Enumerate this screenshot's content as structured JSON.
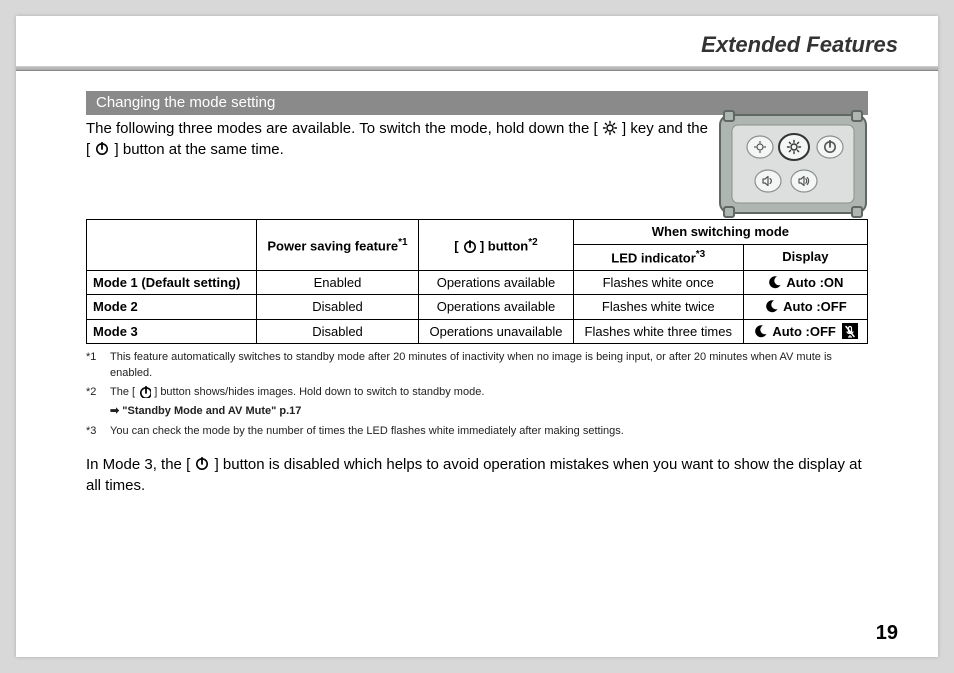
{
  "page": {
    "title": "Extended Features",
    "number": "19"
  },
  "section": {
    "heading": "Changing the mode setting",
    "intro_a": "The following three modes are available. To switch the mode, hold down the [",
    "intro_b": "] key and the [",
    "intro_c": "] button at the same time."
  },
  "icons": {
    "brightness": "brightness-icon",
    "power": "power-icon",
    "moon": "moon-icon",
    "no_mic": "mic-off-icon"
  },
  "table": {
    "headers": {
      "power_saving": "Power saving feature",
      "power_saving_sup": "*1",
      "button_prefix": "[",
      "button_suffix": "] button",
      "button_sup": "*2",
      "switching": "When switching mode",
      "led": "LED indicator",
      "led_sup": "*3",
      "display": "Display"
    },
    "rows": [
      {
        "name": "Mode 1 (Default setting)",
        "power_saving": "Enabled",
        "button": "Operations available",
        "led": "Flashes white once",
        "display_text": "Auto :ON",
        "show_mic_off": false
      },
      {
        "name": "Mode 2",
        "power_saving": "Disabled",
        "button": "Operations available",
        "led": "Flashes white twice",
        "display_text": "Auto :OFF",
        "show_mic_off": false
      },
      {
        "name": "Mode 3",
        "power_saving": "Disabled",
        "button": "Operations unavailable",
        "led": "Flashes white three times",
        "display_text": "Auto :OFF",
        "show_mic_off": true
      }
    ]
  },
  "footnotes": {
    "f1_mark": "*1",
    "f1_text": "This feature automatically switches to standby mode after 20 minutes of inactivity when no image is being input, or after 20 minutes when AV mute is enabled.",
    "f2_mark": "*2",
    "f2_text_a": "The [",
    "f2_text_b": "] button shows/hides images. Hold down to switch to standby mode.",
    "f2_ref": "\"Standby Mode and AV Mute\" p.17",
    "f3_mark": "*3",
    "f3_text": "You can check the mode by the number of times the LED flashes white immediately after making settings."
  },
  "post": {
    "a": "In Mode 3, the [",
    "b": "] button is disabled which helps to avoid operation mistakes when you want to show the display at all times."
  }
}
